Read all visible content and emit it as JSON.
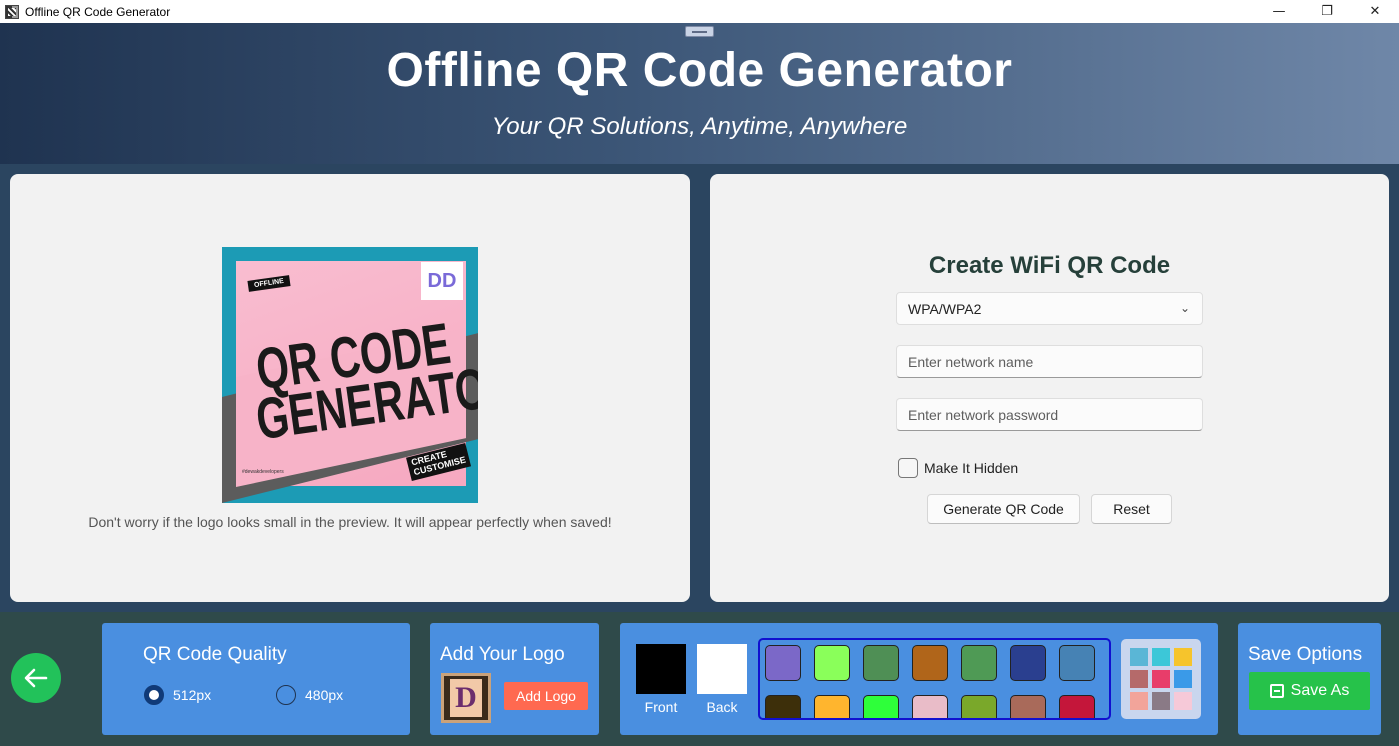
{
  "window": {
    "title": "Offline QR Code Generator",
    "controls": {
      "minimize": "—",
      "restore": "❐",
      "close": "✕"
    }
  },
  "header": {
    "title": "Offline QR Code Generator",
    "subtitle": "Your QR Solutions, Anytime, Anywhere"
  },
  "preview": {
    "image_text": {
      "tag": "OFFLINE",
      "line1": "QR CODE",
      "line2": "GENERATOR",
      "badge": "DD",
      "corner1": "CREATE",
      "corner2": "CUSTOMISE",
      "handle": "#dewakdevelopers"
    },
    "note": "Don't worry if the logo looks small in the preview. It will appear perfectly when saved!"
  },
  "wifi_form": {
    "title": "Create WiFi QR Code",
    "security": {
      "selected": "WPA/WPA2"
    },
    "network_name": {
      "value": "",
      "placeholder": "Enter network name"
    },
    "network_password": {
      "value": "",
      "placeholder": "Enter network password"
    },
    "hidden_checkbox": {
      "label": "Make It Hidden",
      "checked": false
    },
    "generate_label": "Generate QR Code",
    "reset_label": "Reset"
  },
  "bottom": {
    "quality": {
      "title": "QR Code Quality",
      "options": [
        {
          "label": "512px",
          "selected": true
        },
        {
          "label": "480px",
          "selected": false
        }
      ]
    },
    "logo": {
      "title": "Add Your Logo",
      "button_label": "Add Logo",
      "thumb_letter": "D"
    },
    "colors": {
      "front_label": "Front",
      "back_label": "Back",
      "front_color": "#000000",
      "back_color": "#ffffff",
      "palette": [
        "#7b68c8",
        "#8aff5a",
        "#4f8f55",
        "#b0651a",
        "#4f9a55",
        "#2a3f8f",
        "#4682b4",
        "#3d2f0a",
        "#ffb52e",
        "#2eff3a",
        "#e9bcc8",
        "#7aa82a",
        "#a96a5a",
        "#c4163a"
      ]
    },
    "save": {
      "title": "Save Options",
      "button_label": "Save As"
    }
  }
}
